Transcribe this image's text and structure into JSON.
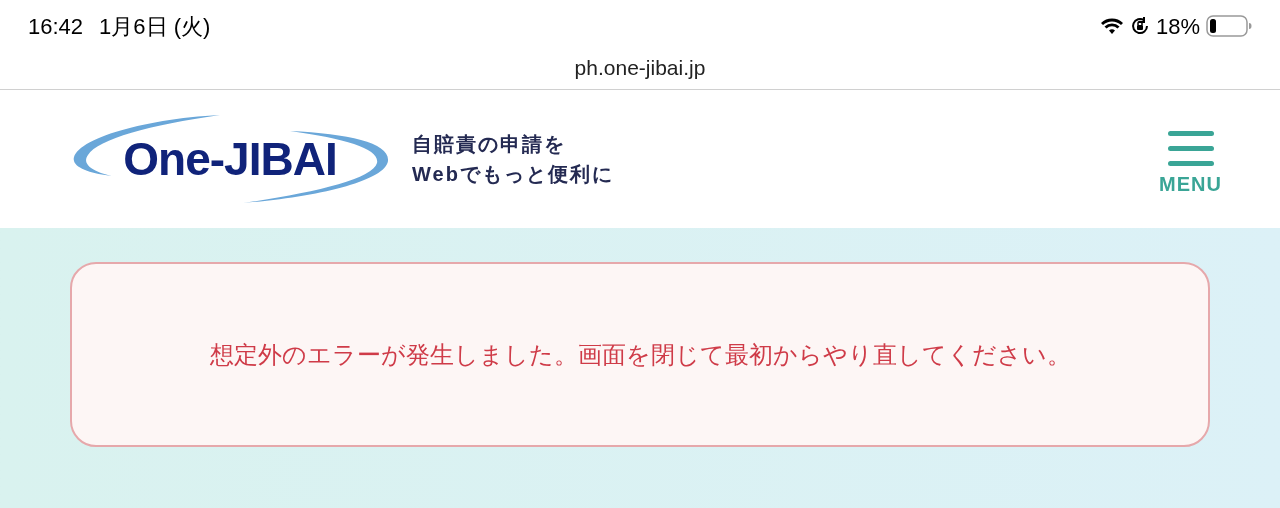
{
  "status_bar": {
    "time": "16:42",
    "date": "1月6日 (火)",
    "battery_percent": "18%"
  },
  "address_bar": {
    "url": "ph.one-jibai.jp"
  },
  "header": {
    "logo": "One-JIBAI",
    "tagline": [
      "自賠責の申請を",
      "Webでもっと便利に"
    ],
    "menu_label": "MENU"
  },
  "error_message": "想定外のエラーが発生しました。画面を閉じて最初からやり直してください。"
}
